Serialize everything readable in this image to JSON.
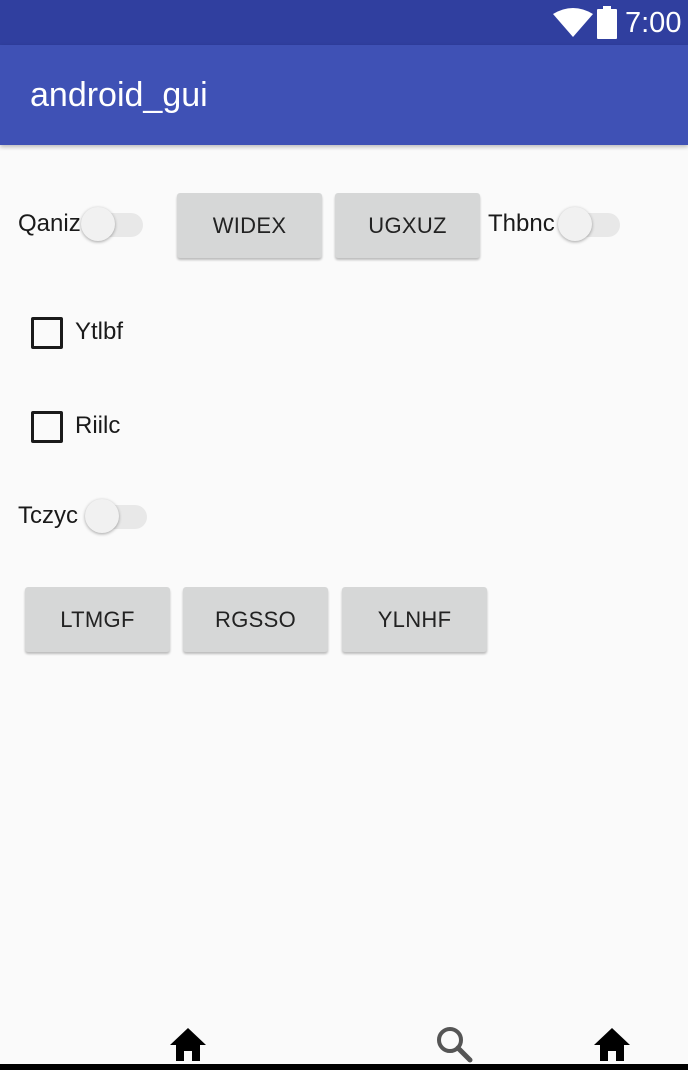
{
  "status_bar": {
    "time": "7:00",
    "wifi_icon": "wifi-icon",
    "battery_icon": "battery-icon"
  },
  "app_bar": {
    "title": "android_gui"
  },
  "content": {
    "switch_qaniz": {
      "label": "Qaniz",
      "checked": false
    },
    "button_widex": {
      "label": "WIDEX"
    },
    "button_ugxuz": {
      "label": "UGXUZ"
    },
    "switch_thbnc": {
      "label": "Thbnc",
      "checked": false
    },
    "checkbox_ytlbf": {
      "label": "Ytlbf",
      "checked": false
    },
    "checkbox_riilc": {
      "label": "Riilc",
      "checked": false
    },
    "switch_tczyc": {
      "label": "Tczyc",
      "checked": false
    },
    "button_ltmgf": {
      "label": "LTMGF"
    },
    "button_rgsso": {
      "label": "RGSSO"
    },
    "button_ylnhf": {
      "label": "YLNHF"
    }
  },
  "bottom_nav": {
    "items": [
      {
        "icon": "home-icon"
      },
      {
        "icon": "search-icon"
      },
      {
        "icon": "home-icon"
      }
    ]
  },
  "colors": {
    "status_bar": "#303f9f",
    "app_bar": "#3f51b5",
    "background": "#fafafa",
    "button": "#d6d7d7"
  }
}
